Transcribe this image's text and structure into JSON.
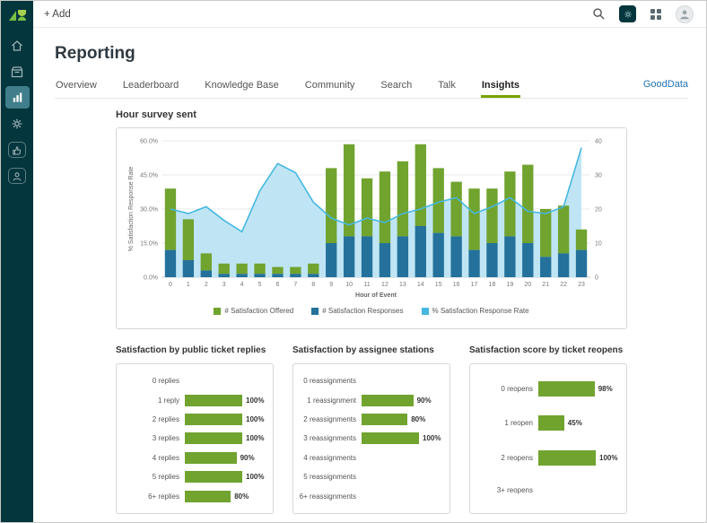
{
  "topbar": {
    "add_label": "+ Add",
    "icons": [
      "search-icon",
      "current-app-icon",
      "apps-grid-icon",
      "avatar"
    ]
  },
  "sidebar": {
    "icons": [
      "logo",
      "home-icon",
      "queue-icon",
      "reports-icon",
      "gear-icon",
      "thumbs-up-icon",
      "person-icon"
    ],
    "active_item": "reports"
  },
  "page": {
    "title": "Reporting"
  },
  "tabs": [
    {
      "label": "Overview",
      "active": false
    },
    {
      "label": "Leaderboard",
      "active": false
    },
    {
      "label": "Knowledge Base",
      "active": false
    },
    {
      "label": "Community",
      "active": false
    },
    {
      "label": "Search",
      "active": false
    },
    {
      "label": "Talk",
      "active": false
    },
    {
      "label": "Insights",
      "active": true
    }
  ],
  "gooddata_label": "GoodData",
  "colors": {
    "green": "#71A32F",
    "blue": "#24719B",
    "lightblue_line": "#45B8E0",
    "lightblue_fill": "#BFE5F5",
    "accent_green": "#78A300",
    "link_blue": "#1F73B7",
    "sidebar_bg": "#03363D",
    "sidebar_active": "#417E8C"
  },
  "chart_data": [
    {
      "type": "bar",
      "subtype": "stacked-bars-with-area-line",
      "title": "Hour survey sent",
      "xlabel": "Hour of Event",
      "ylabel": "% Satisfaction Response Rate",
      "categories": [
        "0",
        "1",
        "2",
        "3",
        "4",
        "5",
        "6",
        "7",
        "8",
        "9",
        "10",
        "11",
        "12",
        "13",
        "14",
        "15",
        "16",
        "17",
        "18",
        "19",
        "20",
        "21",
        "22",
        "23"
      ],
      "series": [
        {
          "name": "# Satisfaction Offered",
          "type": "bar",
          "axis": "right_count",
          "color_key": "green",
          "values": [
            18,
            12,
            5,
            3,
            3,
            3,
            2,
            2,
            3,
            22,
            27,
            17,
            21,
            22,
            24,
            19,
            16,
            18,
            16,
            19,
            23,
            14,
            14,
            6
          ]
        },
        {
          "name": "# Satisfaction Responses",
          "type": "bar",
          "axis": "right_count",
          "color_key": "blue",
          "values": [
            8,
            5,
            2,
            1,
            1,
            1,
            1,
            1,
            1,
            10,
            12,
            12,
            10,
            12,
            15,
            13,
            12,
            8,
            10,
            12,
            10,
            6,
            7,
            8
          ]
        },
        {
          "name": "% Satisfaction Response Rate",
          "type": "area-line",
          "axis": "left_percent",
          "color_key": "lightblue",
          "values": [
            30,
            28,
            31,
            25,
            20,
            38,
            50,
            46,
            33,
            26,
            23,
            26,
            24,
            28,
            30,
            33,
            35,
            28,
            31,
            35,
            29,
            28,
            31,
            57
          ]
        }
      ],
      "left_axis": {
        "min": 0,
        "max": 60,
        "tick_values": [
          0,
          15,
          30,
          45,
          60
        ],
        "ticks": [
          "0.0%",
          "15.0%",
          "30.0%",
          "45.0%",
          "60.0%"
        ]
      },
      "right_axis": {
        "min": 0,
        "max": 40,
        "ticks": [
          0,
          10,
          20,
          30,
          40
        ]
      },
      "legend_position": "bottom",
      "grid": true
    },
    {
      "type": "bar",
      "orientation": "horizontal",
      "title": "Satisfaction by public ticket replies",
      "categories": [
        "0 replies",
        "1 reply",
        "2 replies",
        "3 replies",
        "4 replies",
        "5 replies",
        "6+ replies"
      ],
      "values": [
        null,
        100,
        100,
        100,
        90,
        100,
        80
      ],
      "value_labels": [
        "",
        "100%",
        "100%",
        "100%",
        "90%",
        "100%",
        "80%"
      ],
      "xlim": [
        0,
        100
      ]
    },
    {
      "type": "bar",
      "orientation": "horizontal",
      "title": "Satisfaction by assignee stations",
      "categories": [
        "0 reassignments",
        "1 reassignment",
        "2 reassignments",
        "3 reassignments",
        "4 reassignments",
        "5 reassignments",
        "6+ reassignments"
      ],
      "values": [
        null,
        90,
        80,
        100,
        null,
        null,
        null
      ],
      "value_labels": [
        "",
        "90%",
        "80%",
        "100%",
        "",
        "",
        ""
      ],
      "xlim": [
        0,
        100
      ]
    },
    {
      "type": "bar",
      "orientation": "horizontal",
      "title": "Satisfaction score by ticket reopens",
      "categories": [
        "0 reopens",
        "1 reopen",
        "2 reopens",
        "3+ reopens"
      ],
      "values": [
        98,
        45,
        100,
        null
      ],
      "value_labels": [
        "98%",
        "45%",
        "100%",
        ""
      ],
      "xlim": [
        0,
        100
      ]
    }
  ]
}
